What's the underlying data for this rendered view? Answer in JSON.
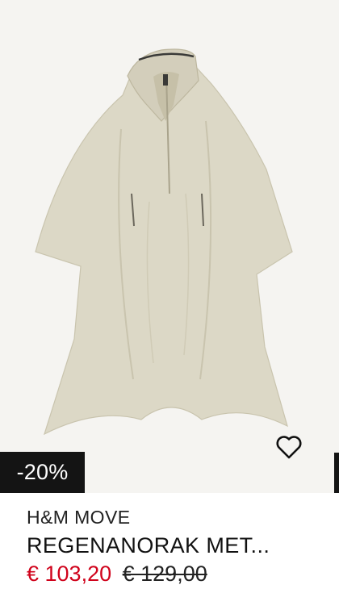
{
  "product": {
    "discount_badge": "-20%",
    "brand": "H&M MOVE",
    "title": "REGENANORAK MET...",
    "price_sale": "€ 103,20",
    "price_old": "€ 129,00",
    "colors": {
      "sale": "#d0021b",
      "badge_bg": "#141414",
      "garment": "#dcd8c6"
    }
  },
  "icons": {
    "favorite": "heart-outline-icon"
  }
}
